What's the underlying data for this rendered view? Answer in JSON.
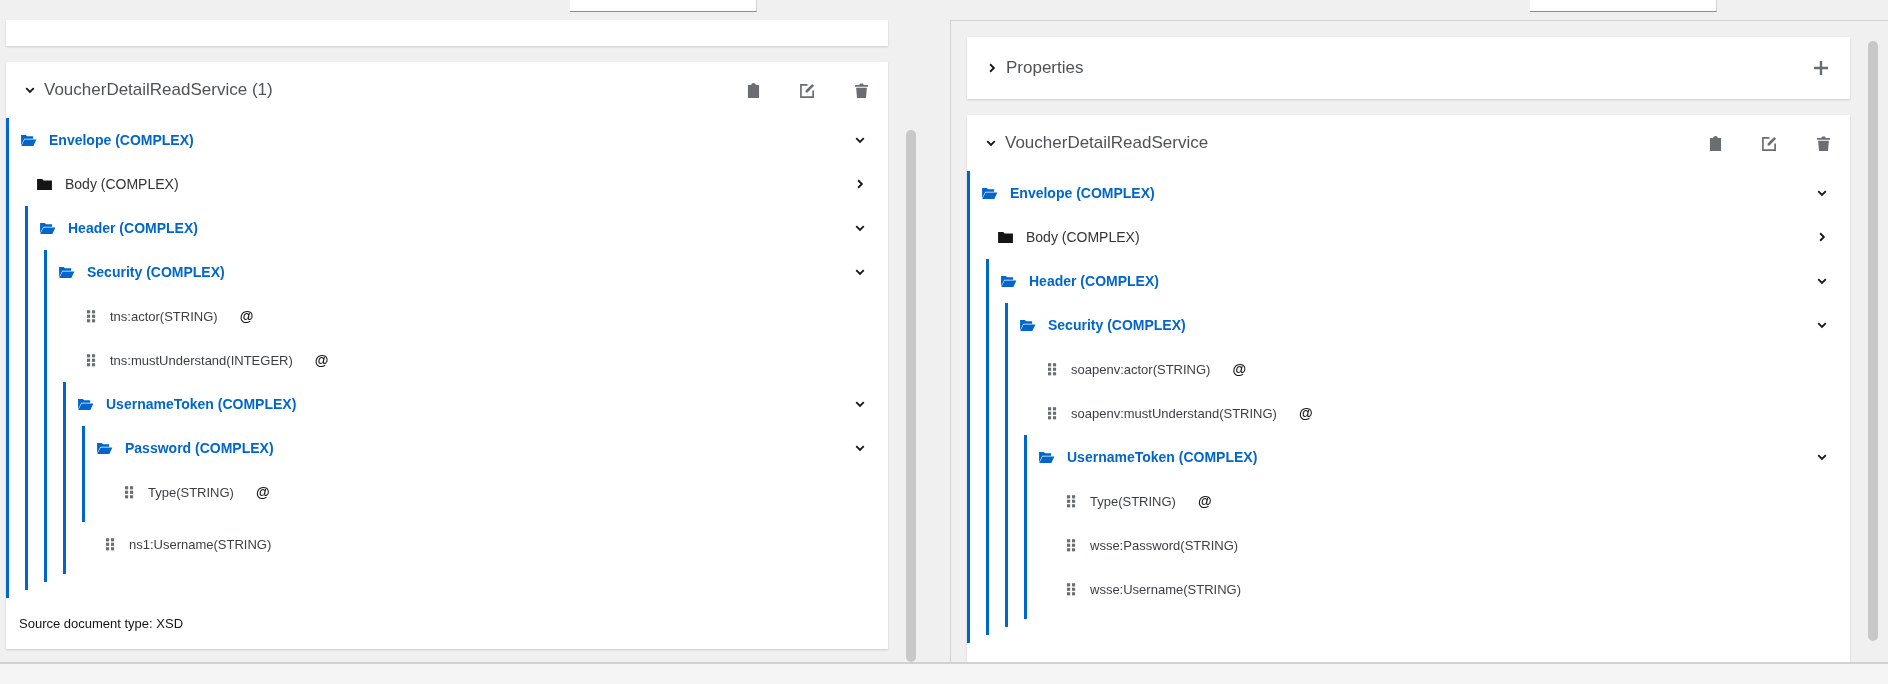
{
  "source": {
    "document_card": {
      "title": "VoucherDetailReadService (1)",
      "expanded": true,
      "tree": [
        {
          "label": "Envelope (COMPLEX)",
          "kind": "folder",
          "expanded": true,
          "children": [
            {
              "label": "Body (COMPLEX)",
              "kind": "folder",
              "expanded": false
            },
            {
              "label": "Header (COMPLEX)",
              "kind": "folder",
              "expanded": true,
              "children": [
                {
                  "label": "Security (COMPLEX)",
                  "kind": "folder",
                  "expanded": true,
                  "children": [
                    {
                      "label": "tns:actor(STRING)",
                      "kind": "field",
                      "badge": "@"
                    },
                    {
                      "label": "tns:mustUnderstand(INTEGER)",
                      "kind": "field",
                      "badge": "@"
                    },
                    {
                      "label": "UsernameToken (COMPLEX)",
                      "kind": "folder",
                      "expanded": true,
                      "children": [
                        {
                          "label": "Password (COMPLEX)",
                          "kind": "folder",
                          "expanded": true,
                          "children": [
                            {
                              "label": "Type(STRING)",
                              "kind": "field",
                              "badge": "@"
                            }
                          ]
                        },
                        {
                          "label": "ns1:Username(STRING)",
                          "kind": "field"
                        }
                      ]
                    }
                  ]
                }
              ]
            }
          ]
        }
      ],
      "footer": "Source document type: XSD"
    }
  },
  "target": {
    "properties": {
      "title": "Properties",
      "expanded": false
    },
    "document_card": {
      "title": "VoucherDetailReadService",
      "expanded": true,
      "tree": [
        {
          "label": "Envelope (COMPLEX)",
          "kind": "folder",
          "expanded": true,
          "children": [
            {
              "label": "Body (COMPLEX)",
              "kind": "folder",
              "expanded": false
            },
            {
              "label": "Header (COMPLEX)",
              "kind": "folder",
              "expanded": true,
              "children": [
                {
                  "label": "Security (COMPLEX)",
                  "kind": "folder",
                  "expanded": true,
                  "children": [
                    {
                      "label": "soapenv:actor(STRING)",
                      "kind": "field",
                      "badge": "@"
                    },
                    {
                      "label": "soapenv:mustUnderstand(STRING)",
                      "kind": "field",
                      "badge": "@"
                    },
                    {
                      "label": "UsernameToken (COMPLEX)",
                      "kind": "folder",
                      "expanded": true,
                      "children": [
                        {
                          "label": "Type(STRING)",
                          "kind": "field",
                          "badge": "@"
                        },
                        {
                          "label": "wsse:Password(STRING)",
                          "kind": "field"
                        },
                        {
                          "label": "wsse:Username(STRING)",
                          "kind": "field"
                        }
                      ]
                    }
                  ]
                }
              ]
            }
          ]
        }
      ]
    }
  }
}
